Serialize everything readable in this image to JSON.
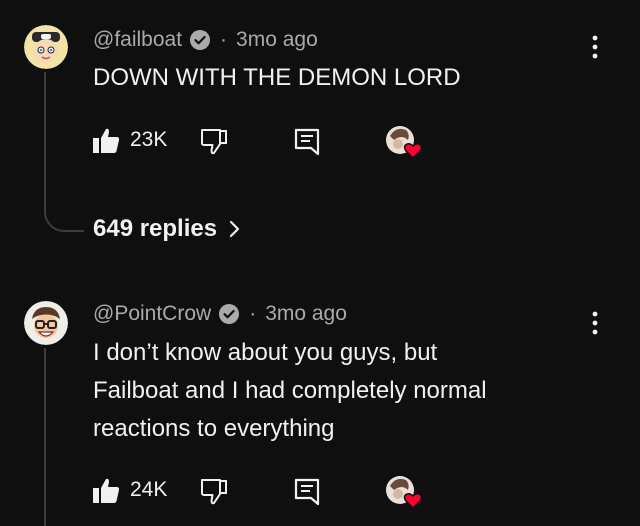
{
  "comments": [
    {
      "author": "@failboat",
      "separator": "·",
      "time": "3mo ago",
      "text": "DOWN WITH THE DEMON LORD",
      "likes": "23K",
      "replies_label": "649 replies"
    },
    {
      "author": "@PointCrow",
      "separator": "·",
      "time": "3mo ago",
      "text": "I don’t know about you guys, but\nFailboat and I had completely normal\nreactions to everything",
      "likes": "24K"
    }
  ],
  "colors": {
    "background": "#0f0f0f",
    "primary_text": "#f1f1f1",
    "secondary_text": "#aaaaaa",
    "thread_line": "#3d3d3d",
    "heart": "#ff0033"
  },
  "icons": {
    "like": "thumbs-up-icon",
    "dislike": "thumbs-down-icon",
    "reply": "comment-icon",
    "creator_heart": "creator-heart-icon",
    "more": "more-vert-icon",
    "verified": "verified-check-icon"
  }
}
